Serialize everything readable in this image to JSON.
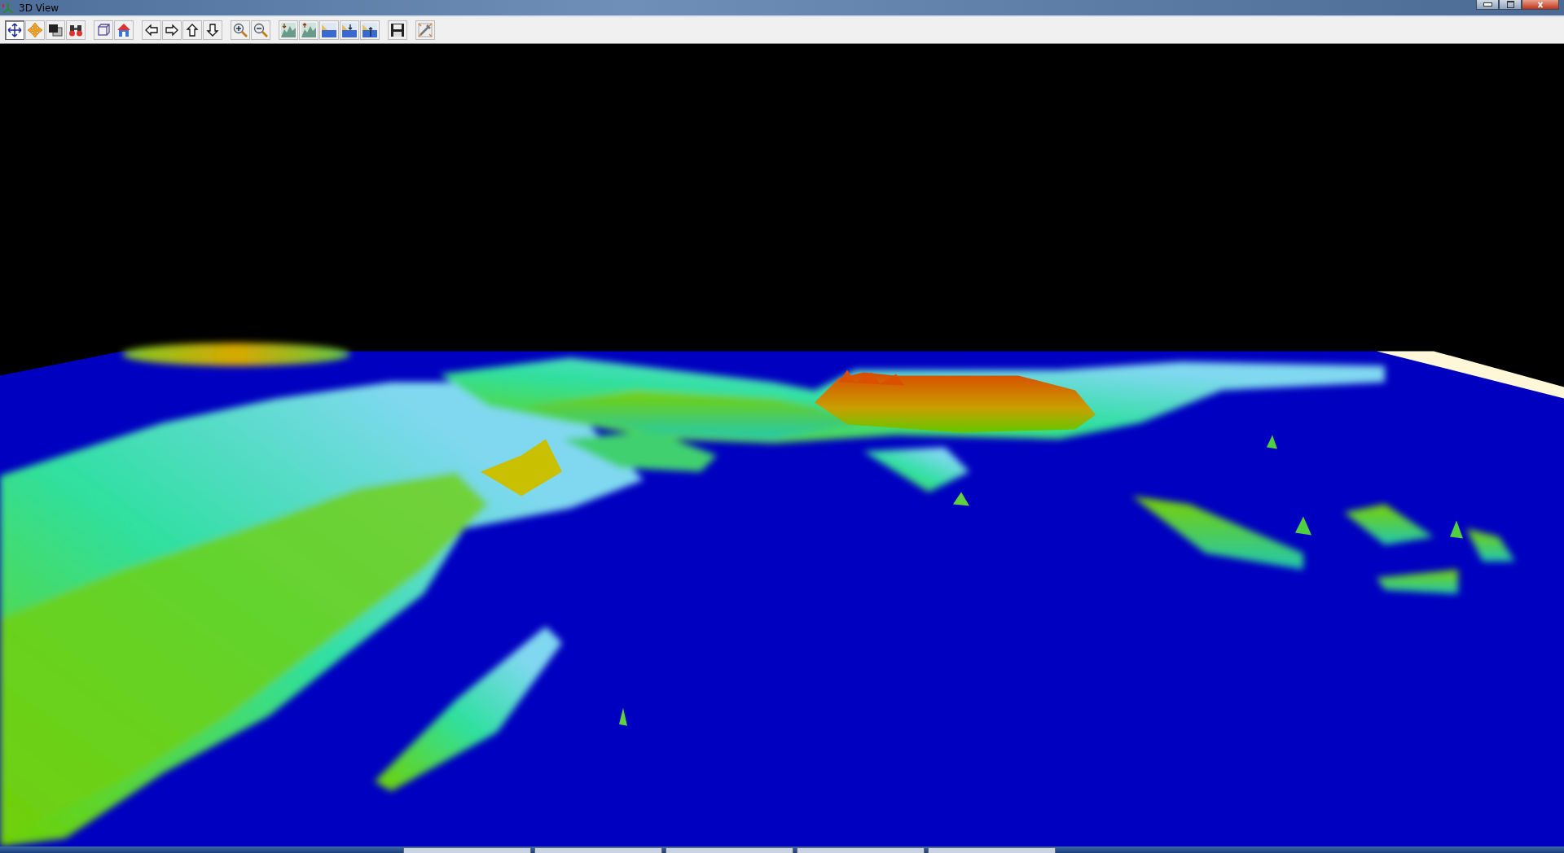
{
  "window": {
    "title": "3D View"
  },
  "toolbar": {
    "groups": [
      {
        "tools": [
          {
            "kind": "pan",
            "selected": true
          },
          {
            "kind": "move",
            "selected": false
          },
          {
            "kind": "layers",
            "selected": false
          },
          {
            "kind": "binoculars",
            "selected": false
          }
        ]
      },
      {
        "tools": [
          {
            "kind": "cube",
            "selected": false
          },
          {
            "kind": "home",
            "selected": false
          }
        ]
      },
      {
        "tools": [
          {
            "kind": "left",
            "selected": false
          },
          {
            "kind": "right",
            "selected": false
          },
          {
            "kind": "up",
            "selected": false
          },
          {
            "kind": "down",
            "selected": false
          }
        ]
      },
      {
        "tools": [
          {
            "kind": "zoom-in",
            "selected": false
          },
          {
            "kind": "zoom-out",
            "selected": false
          }
        ]
      },
      {
        "tools": [
          {
            "kind": "terrain-down",
            "selected": false
          },
          {
            "kind": "terrain-up",
            "selected": false
          },
          {
            "kind": "water",
            "selected": false
          },
          {
            "kind": "water-down",
            "selected": false
          },
          {
            "kind": "water-up",
            "selected": false
          }
        ]
      },
      {
        "tools": [
          {
            "kind": "save",
            "selected": false
          }
        ]
      },
      {
        "tools": [
          {
            "kind": "settings",
            "selected": false
          }
        ]
      }
    ]
  }
}
